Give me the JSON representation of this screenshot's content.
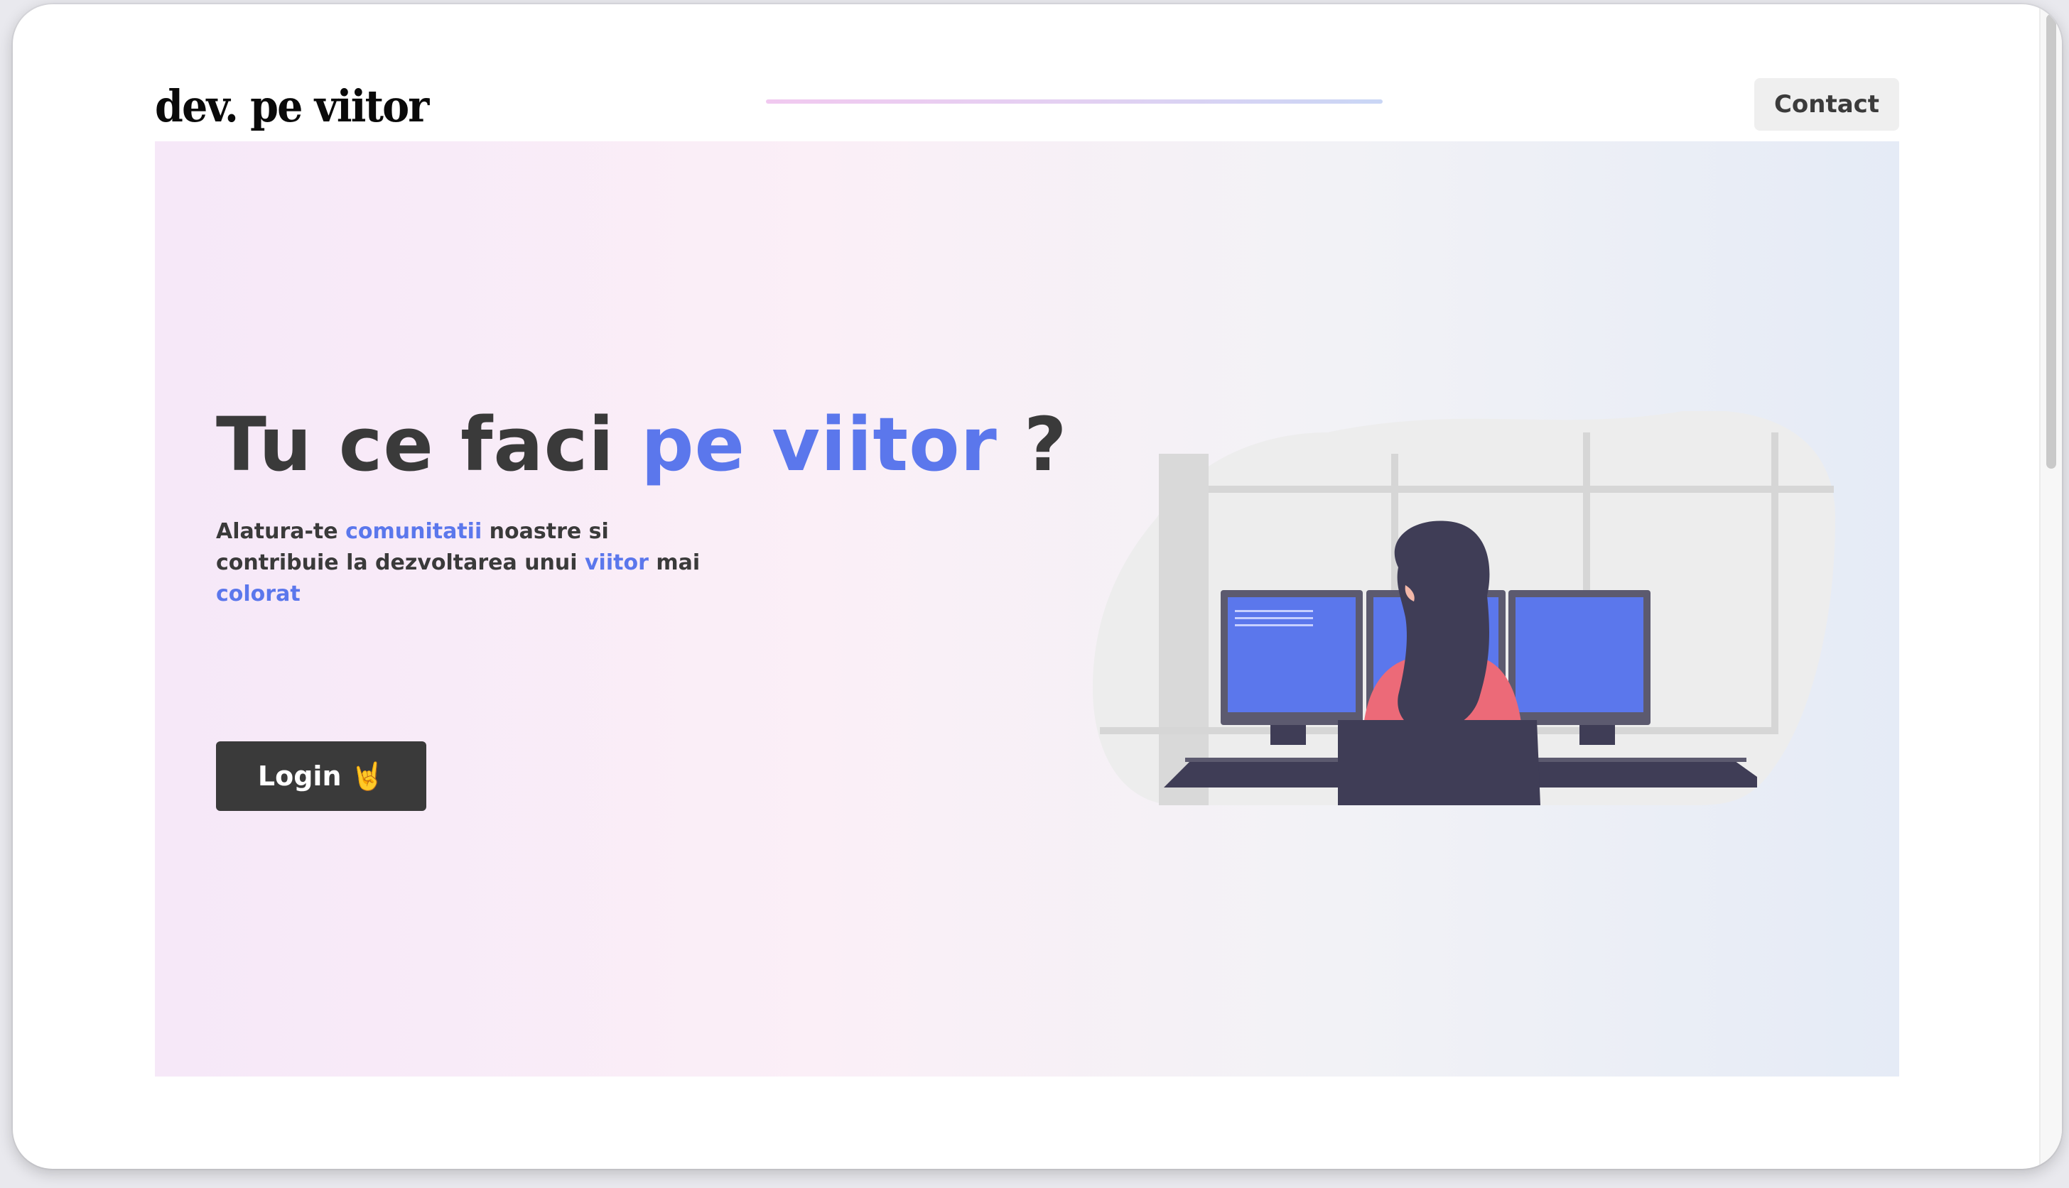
{
  "header": {
    "logo": "dev. pe viitor",
    "contact_label": "Contact"
  },
  "hero": {
    "title": {
      "prefix": "Tu ce faci ",
      "accent": "pe viitor",
      "suffix": " ?"
    },
    "subtitle": [
      {
        "text": "Alatura-te ",
        "accent": false
      },
      {
        "text": "comunitatii",
        "accent": true
      },
      {
        "text": " noastre si contribuie la dezvoltarea unui ",
        "accent": false
      },
      {
        "text": "viitor",
        "accent": true
      },
      {
        "text": " mai ",
        "accent": false
      },
      {
        "text": "colorat",
        "accent": true
      }
    ],
    "login_label": "Login",
    "login_emoji": "🤘"
  },
  "icons": {
    "login": "rock-hand-icon",
    "illustration": "woman-at-monitors-illustration"
  },
  "colors": {
    "accent": "#5b77ec",
    "text_dark": "#3a3a3a",
    "button_dark": "#3a3a3a",
    "contact_bg": "#efefef",
    "illustration_shirt": "#ec6a78",
    "illustration_hair": "#3f3d56"
  }
}
